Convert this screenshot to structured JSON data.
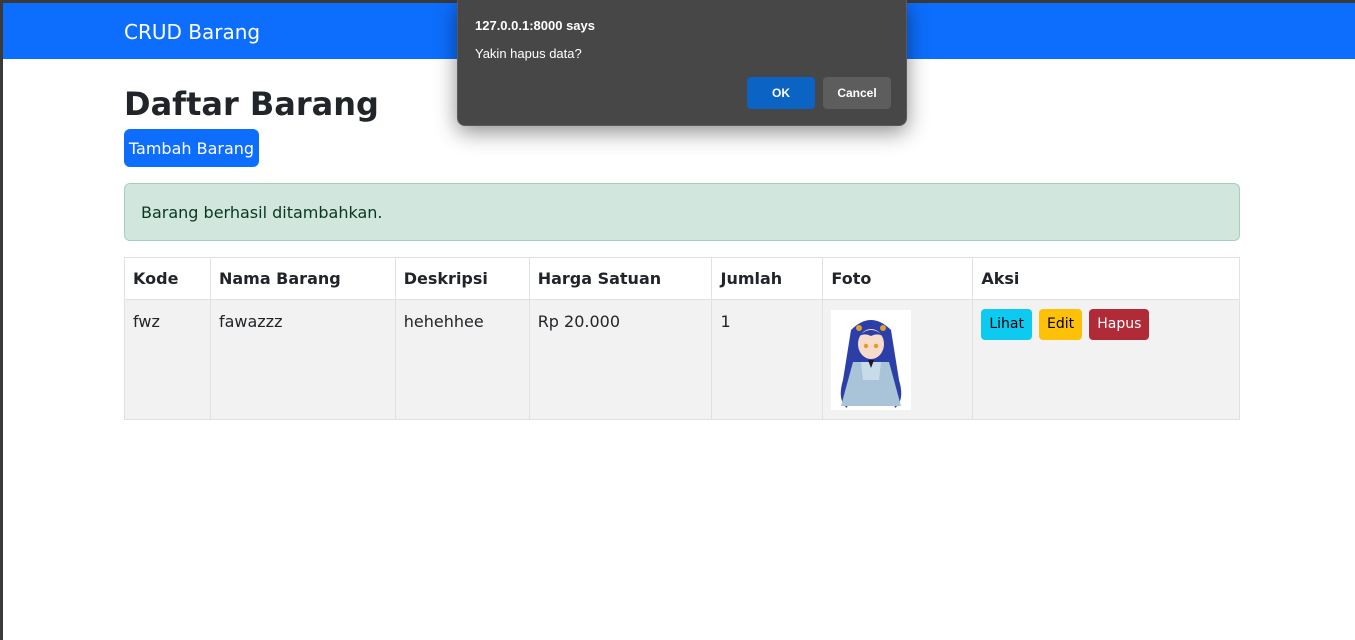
{
  "navbar": {
    "brand": "CRUD Barang",
    "color": "#0d6efd"
  },
  "page": {
    "title": "Daftar Barang",
    "add_button": "Tambah Barang"
  },
  "alert": {
    "message": "Barang berhasil ditambahkan.",
    "color": "#d1e7dd"
  },
  "table": {
    "headers": [
      "Kode",
      "Nama Barang",
      "Deskripsi",
      "Harga Satuan",
      "Jumlah",
      "Foto",
      "Aksi"
    ],
    "rows": [
      {
        "kode": "fwz",
        "nama": "fawazzz",
        "deskripsi": "hehehhee",
        "harga": "Rp 20.000",
        "jumlah": "1",
        "foto": "anime-girl-image",
        "actions": {
          "view": "Lihat",
          "edit": "Edit",
          "delete": "Hapus"
        }
      }
    ]
  },
  "dialog": {
    "title": "127.0.0.1:8000 says",
    "message": "Yakin hapus data?",
    "ok": "OK",
    "cancel": "Cancel"
  }
}
